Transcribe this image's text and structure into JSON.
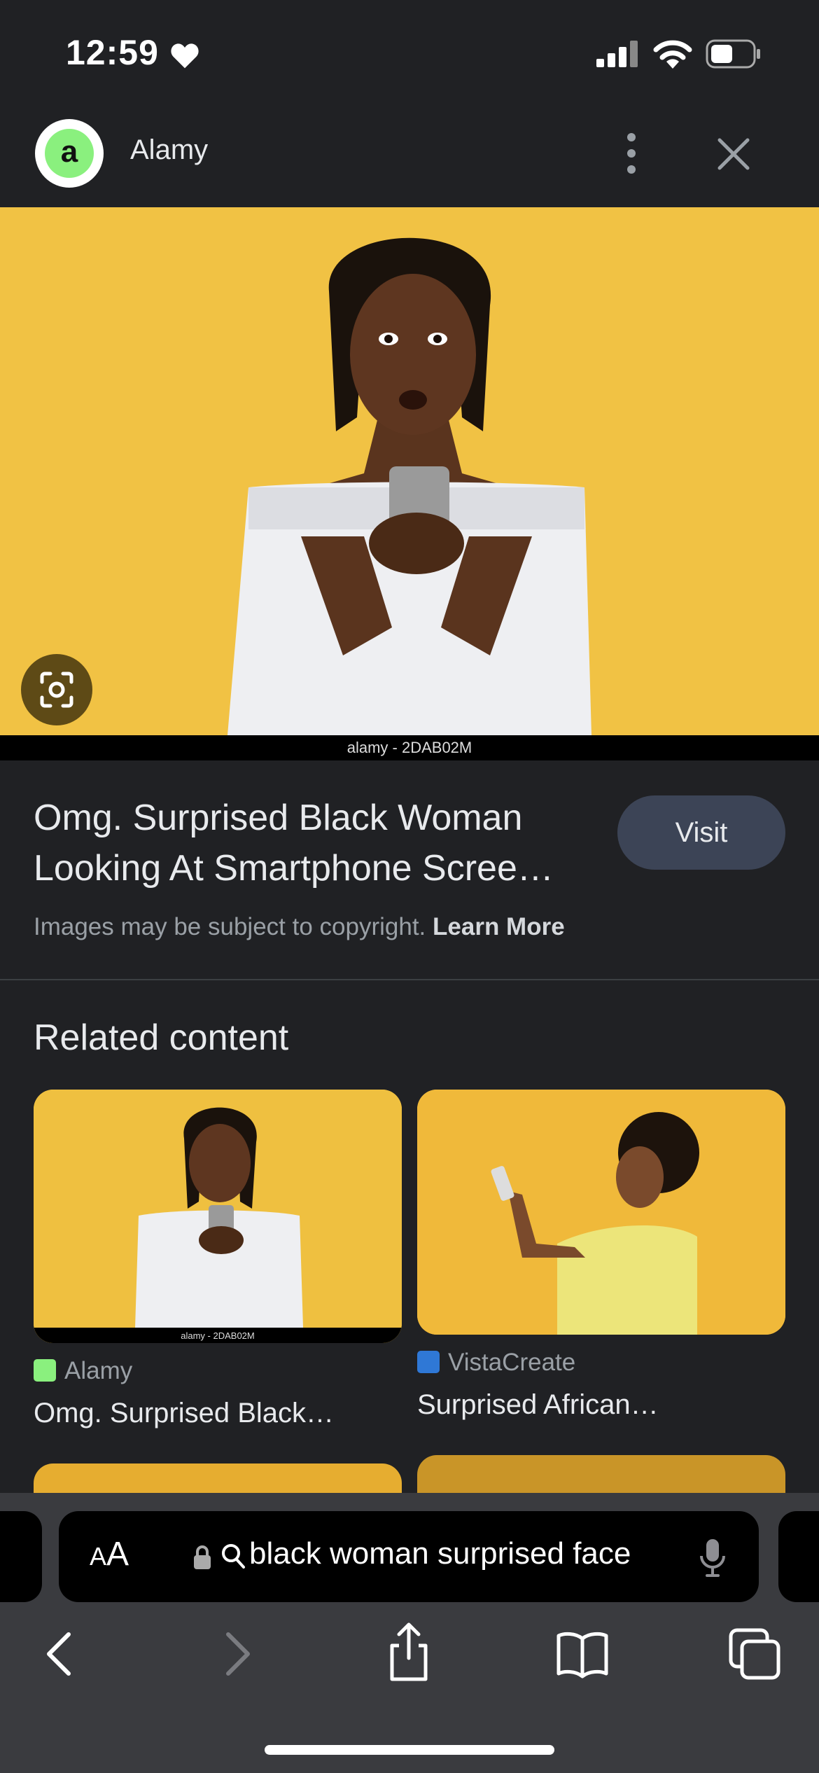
{
  "status_bar": {
    "time": "12:59"
  },
  "header": {
    "logo_letter": "a",
    "site_name": "Alamy"
  },
  "hero": {
    "watermark": "alamy - 2DAB02M"
  },
  "result": {
    "title": "Omg. Surprised Black Woman Looking At Smartphone Scree…",
    "visit_label": "Visit",
    "copyright_text": "Images may be subject to copyright.",
    "learn_more": "Learn More"
  },
  "related": {
    "heading": "Related content",
    "cards": [
      {
        "source": "Alamy",
        "title": "Omg. Surprised Black…",
        "watermark": "alamy - 2DAB02M",
        "favicon_color": "#8af07e"
      },
      {
        "source": "VistaCreate",
        "title": "Surprised African…",
        "favicon_color": "#2f78d6"
      }
    ]
  },
  "address_bar": {
    "aa_label_small": "A",
    "aa_label_large": "A",
    "query": "black woman surprised face"
  },
  "colors": {
    "background": "#202124",
    "hero_yellow": "#f1c244",
    "visit_button": "#3c4456",
    "toolbar": "#3a3b3f"
  }
}
